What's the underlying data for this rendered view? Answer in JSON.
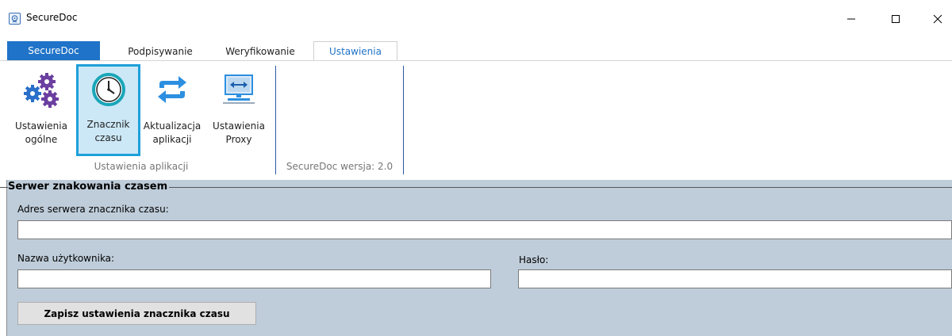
{
  "window": {
    "title": "SecureDoc",
    "icon": "app-seal-icon",
    "controls": [
      "minimize-icon",
      "maximize-icon",
      "close-icon"
    ]
  },
  "tabs": {
    "file": "SecureDoc",
    "items": [
      {
        "label": "Podpisywanie"
      },
      {
        "label": "Weryfikowanie"
      },
      {
        "label": "Ustawienia",
        "active": true
      }
    ]
  },
  "ribbon": {
    "buttons": [
      {
        "line1": "Ustawienia",
        "line2": "ogólne",
        "icon": "gears-icon"
      },
      {
        "line1": "Znacznik",
        "line2": "czasu",
        "icon": "clock-icon",
        "selected": true
      },
      {
        "line1": "Aktualizacja",
        "line2": "aplikacji",
        "icon": "refresh-arrows-icon"
      },
      {
        "line1": "Ustawienia",
        "line2": "Proxy",
        "icon": "network-monitor-icon"
      }
    ],
    "group1_label": "Ustawienia aplikacji",
    "group2_label": "SecureDoc wersja: 2.0"
  },
  "panel": {
    "legend": "Serwer znakowania czasem",
    "server_label": "Adres serwera znacznika czasu:",
    "server_value": "",
    "username_label": "Nazwa użytkownika:",
    "username_value": "",
    "password_label": "Hasło:",
    "password_value": "",
    "save_label": "Zapisz ustawienia znacznika czasu"
  },
  "colors": {
    "accent": "#1f73c8",
    "selection_border": "#1ea0d9",
    "selection_fill": "#cce8f7",
    "panel_bg": "#bfcdda",
    "gear_blue": "#2a6fc9",
    "gear_purple": "#6b3fa0",
    "clock_teal": "#18a6b8"
  }
}
